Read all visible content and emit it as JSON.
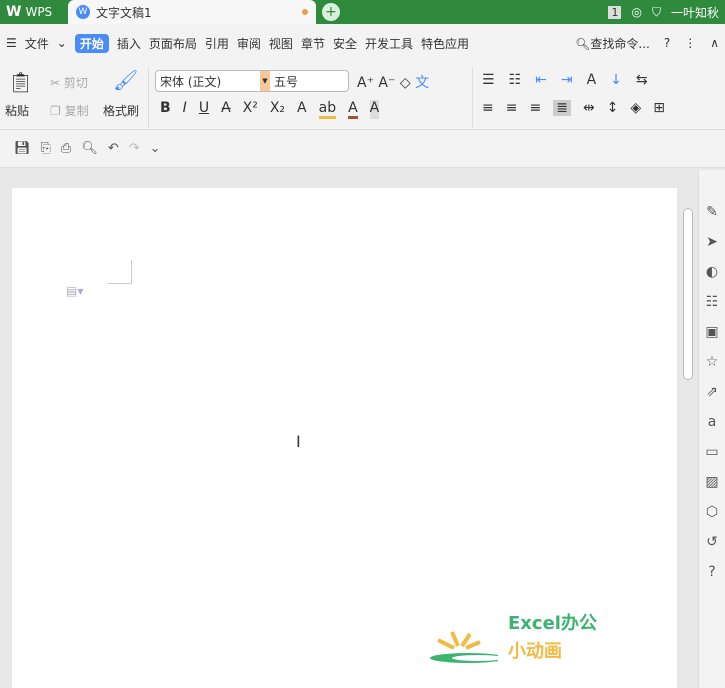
{
  "titlebar": {
    "app": "WPS",
    "doc_tab": "文字文稿1",
    "badge": "1",
    "user": "一叶知秋"
  },
  "menu": {
    "items": [
      "文件",
      "开始",
      "插入",
      "页面布局",
      "引用",
      "审阅",
      "视图",
      "章节",
      "安全",
      "开发工具",
      "特色应用"
    ],
    "search": "查找命令..."
  },
  "ribbon": {
    "paste": "粘贴",
    "cut": "剪切",
    "copy": "复制",
    "format_painter": "格式刷",
    "font": "宋体 (正文)",
    "size": "五号"
  },
  "watermark": {
    "line1": "Excel办公",
    "line2": "小动画"
  },
  "colors": {
    "accent": "#4a8cf7",
    "title_bg": "#2f8a3e"
  }
}
